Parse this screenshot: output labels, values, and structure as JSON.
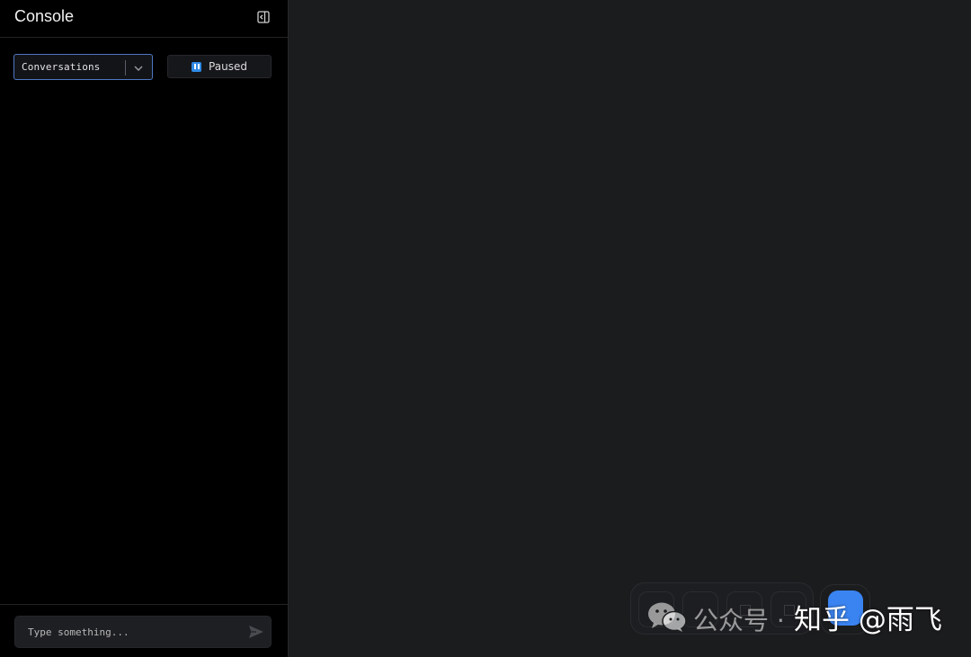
{
  "sidebar": {
    "title": "Console",
    "collapse_icon": "sidebar-collapse-icon",
    "view_select": {
      "value": "Conversations",
      "chevron_icon": "chevron-down-icon"
    },
    "status": {
      "label": "Paused",
      "icon": "pause-icon",
      "icon_color": "#2f8be6"
    },
    "composer": {
      "placeholder": "Type something...",
      "send_icon": "send-icon"
    }
  },
  "controls": {
    "mic_color": "#3a84f2"
  },
  "watermark": {
    "wechat_icon": "wechat-icon",
    "account_text": "公众号 ·",
    "zhihu_text": "知乎 @雨飞"
  },
  "colors": {
    "sidebar_bg": "#000000",
    "main_bg": "#1b1c1e",
    "accent": "#4d77c4"
  }
}
